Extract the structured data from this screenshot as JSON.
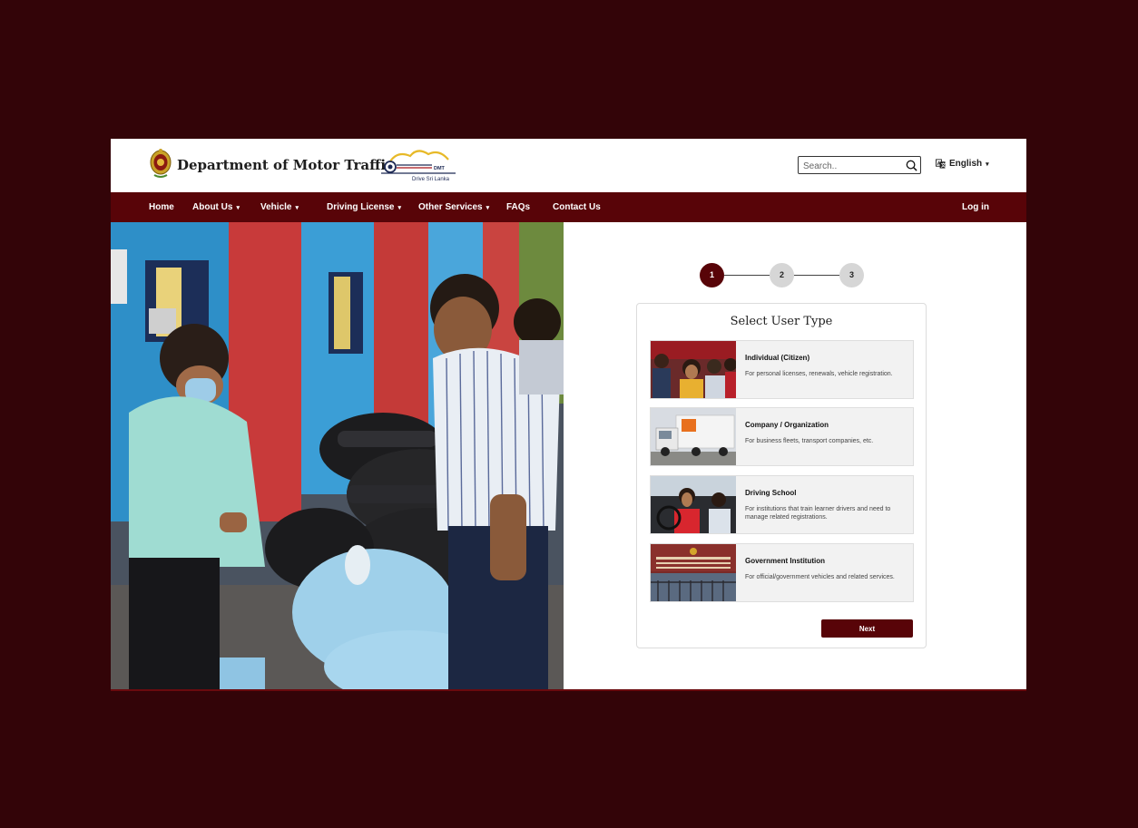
{
  "header": {
    "title": "Department of Motor Traffic",
    "logo_text": "DMT",
    "logo_tagline": "Drive Sri Lanka",
    "search_placeholder": "Search..",
    "language": "English"
  },
  "nav": {
    "items": [
      {
        "label": "Home",
        "has_dropdown": false
      },
      {
        "label": "About Us",
        "has_dropdown": true
      },
      {
        "label": "Vehicle",
        "has_dropdown": true
      },
      {
        "label": "Driving License",
        "has_dropdown": true
      },
      {
        "label": "Other Services",
        "has_dropdown": true
      },
      {
        "label": "FAQs",
        "has_dropdown": false
      },
      {
        "label": "Contact Us",
        "has_dropdown": false
      }
    ],
    "login_label": "Log in",
    "dropdown_caret": "▾"
  },
  "stepper": {
    "steps": [
      "1",
      "2",
      "3"
    ],
    "active_step": 1
  },
  "user_type_card": {
    "title": "Select User Type",
    "options": [
      {
        "title": "Individual (Citizen)",
        "description": "For personal licenses, renewals, vehicle registration."
      },
      {
        "title": "Company / Organization",
        "description": "For business fleets, transport companies, etc."
      },
      {
        "title": "Driving School",
        "description": "For institutions that train learner drivers and need to manage related registrations."
      },
      {
        "title": "Government Institution",
        "description": "For official/government vehicles and related services."
      }
    ],
    "next_label": "Next"
  },
  "colors": {
    "brand_maroon": "#580408",
    "page_background": "#330408",
    "option_background": "#f2f2f2",
    "step_inactive": "#d6d6d6"
  },
  "icons": {
    "search": "search-icon",
    "language": "translate-icon",
    "emblem": "sri-lanka-emblem"
  }
}
